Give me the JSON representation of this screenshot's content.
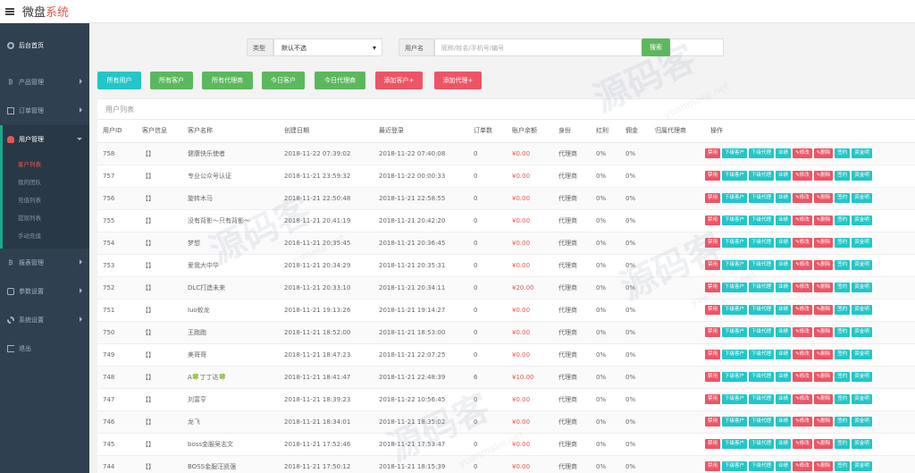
{
  "header": {
    "brand_main": "微盘",
    "brand_accent": "系统"
  },
  "sidebar": {
    "home": "后台首页",
    "items": [
      "产品管理",
      "订单管理",
      "用户管理"
    ],
    "submenu": [
      "客户列表",
      "我的团队",
      "充值列表",
      "提现列表",
      "手动充值"
    ],
    "bottom": [
      "报表管理",
      "参数设置",
      "系统设置",
      "退出"
    ]
  },
  "search": {
    "type_label": "类型",
    "type_value": "默认不选",
    "user_label": "用户名",
    "user_placeholder": "昵称/姓名/手机号/编号",
    "search_button": "搜索"
  },
  "filters": [
    "所有用户",
    "所有客户",
    "所有代理商",
    "今日客户",
    "今日代理商",
    "添加客户+",
    "添加代理+"
  ],
  "panel_title": "用户列表",
  "table": {
    "headers": [
      "用户ID",
      "客户信息",
      "客户名称",
      "创建日期",
      "最近登录",
      "订单数",
      "账户余额",
      "身份",
      "红利",
      "佣金",
      "归属代理商",
      "操作"
    ],
    "actions": [
      "禁用",
      "下级客户",
      "下级代理",
      "业绩",
      "✎修改",
      "✎删除",
      "签约",
      "资金明"
    ],
    "rows": [
      [
        "758",
        "【】",
        "健康快乐使者",
        "2018-11-22 07:39:02",
        "2018-11-22 07:40:08",
        "0",
        "¥0.00",
        "代理商",
        "0%",
        "0%",
        ""
      ],
      [
        "757",
        "【】",
        "专业公众号认证",
        "2018-11-21 23:59:32",
        "2018-11-22 00:00:33",
        "0",
        "¥0.00",
        "代理商",
        "0%",
        "0%",
        ""
      ],
      [
        "756",
        "【】",
        "旋转木马",
        "2018-11-21 22:50:48",
        "2018-11-21 22:58:55",
        "0",
        "¥0.00",
        "代理商",
        "0%",
        "0%",
        ""
      ],
      [
        "755",
        "【】",
        "没有背影～只有背影～",
        "2018-11-21 20:41:19",
        "2018-11-21 20:42:20",
        "0",
        "¥0.00",
        "代理商",
        "0%",
        "0%",
        ""
      ],
      [
        "754",
        "【】",
        "梦想",
        "2018-11-21 20:35:45",
        "2018-11-21 20:36:45",
        "0",
        "¥0.00",
        "代理商",
        "0%",
        "0%",
        ""
      ],
      [
        "753",
        "【】",
        "爱我大中华",
        "2018-11-21 20:34:29",
        "2018-11-21 20:35:31",
        "0",
        "¥0.00",
        "代理商",
        "0%",
        "0%",
        ""
      ],
      [
        "752",
        "【】",
        "DLC打造未来",
        "2018-11-21 20:33:10",
        "2018-11-21 20:34:11",
        "0",
        "¥20.00",
        "代理商",
        "0%",
        "0%",
        ""
      ],
      [
        "751",
        "【】",
        "luo蛟龙",
        "2018-11-21 19:13:26",
        "2018-11-21 19:14:27",
        "0",
        "¥0.00",
        "代理商",
        "0%",
        "0%",
        ""
      ],
      [
        "750",
        "【】",
        "王跑跑",
        "2018-11-21 18:52:00",
        "2018-11-21 18:53:00",
        "0",
        "¥0.00",
        "代理商",
        "0%",
        "0%",
        ""
      ],
      [
        "749",
        "【】",
        "美哥哥",
        "2018-11-21 18:47:23",
        "2018-11-21 22:07:25",
        "0",
        "¥0.00",
        "代理商",
        "0%",
        "0%",
        ""
      ],
      [
        "748",
        "【】",
        "A🍀丁丁达🍀",
        "2018-11-21 18:41:47",
        "2018-11-21 22:48:39",
        "6",
        "¥10.00",
        "代理商",
        "0%",
        "0%",
        ""
      ],
      [
        "747",
        "【】",
        "刘富亨",
        "2018-11-21 18:39:23",
        "2018-11-22 10:56:45",
        "0",
        "¥0.00",
        "代理商",
        "0%",
        "0%",
        ""
      ],
      [
        "746",
        "【】",
        "龙飞",
        "2018-11-21 18:34:01",
        "2018-11-21 18:35:02",
        "0",
        "¥0.00",
        "代理商",
        "0%",
        "0%",
        ""
      ],
      [
        "745",
        "【】",
        "boss金服吴志文",
        "2018-11-21 17:52:46",
        "2018-11-21 17:53:47",
        "0",
        "¥0.00",
        "代理商",
        "0%",
        "0%",
        ""
      ],
      [
        "744",
        "【】",
        "BOSS金服汪凯强",
        "2018-11-21 17:50:12",
        "2018-11-21 18:15:39",
        "0",
        "¥0.00",
        "代理商",
        "0%",
        "0%",
        ""
      ]
    ]
  },
  "watermark": {
    "main": "源码客",
    "sub": "yuanmake.net"
  },
  "colors": {
    "sidebar_bg": "#2f4050",
    "accent_red": "#e8554e",
    "cyan": "#23c6c8",
    "green": "#5cb85c",
    "danger": "#ed5565"
  }
}
